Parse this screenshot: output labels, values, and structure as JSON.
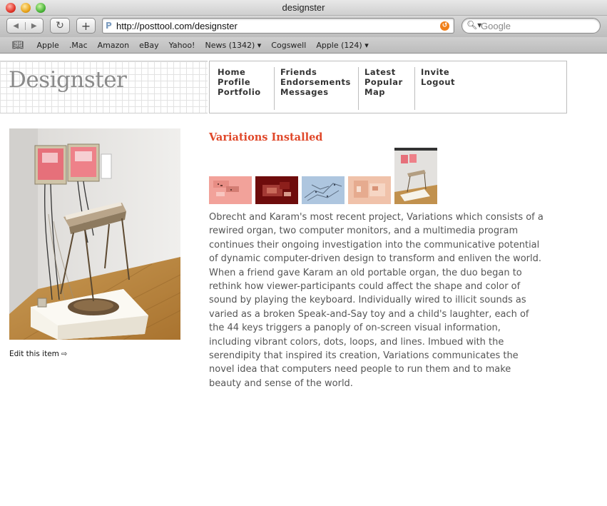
{
  "window": {
    "title": "designster"
  },
  "toolbar": {
    "back_icon": "◀",
    "forward_icon": "▶",
    "reload_icon": "↻",
    "add_icon": "+",
    "url": "http://posttool.com/designster",
    "search_placeholder": "Google"
  },
  "bookmarks": [
    "Apple",
    ".Mac",
    "Amazon",
    "eBay",
    "Yahoo!",
    "News (1342) ▾",
    "Cogswell",
    "Apple (124) ▾"
  ],
  "site": {
    "logo": "Designster",
    "nav": {
      "col1": [
        "Home",
        "Profile",
        "Portfolio"
      ],
      "col2": [
        "Friends",
        "Endorsements",
        "Messages"
      ],
      "col3": [
        "Latest",
        "Popular",
        "Map"
      ],
      "col4": [
        "Invite",
        "Logout"
      ]
    }
  },
  "item": {
    "title": "Variations Installed",
    "edit_label": "Edit this item",
    "edit_arrow": "⇨",
    "description": "Obrecht and Karam's most recent project, Variations which consists of a rewired organ, two computer monitors, and a multimedia program continues their ongoing investigation into the communicative potential of dynamic computer-driven design to transform and enliven the world. When a friend gave Karam an old portable organ, the duo began to rethink how viewer-participants could affect the shape and color of sound by playing the keyboard. Individually wired to illicit sounds as varied as a broken Speak-and-Say toy and a child's laughter, each of the 44 keys triggers a panoply of on-screen visual information, including vibrant colors, dots, loops, and lines. Imbued with the serendipity that inspired its creation, Variations communicates the novel idea that computers need people to run them and to make beauty and sense of the world."
  },
  "colors": {
    "title_accent": "#e0482a",
    "body_text": "#555555",
    "nav_text": "#333333"
  }
}
